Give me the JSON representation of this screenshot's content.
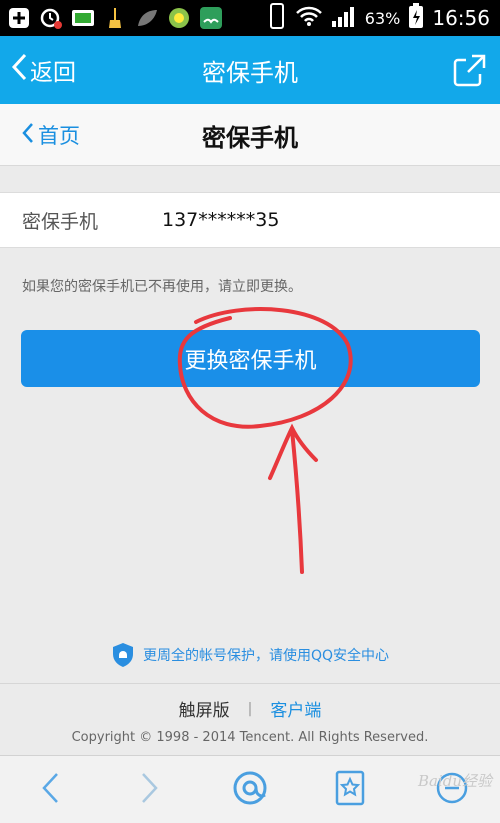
{
  "status_bar": {
    "battery_percent": "63%",
    "time": "16:56"
  },
  "app_bar": {
    "back_label": "返回",
    "title": "密保手机"
  },
  "page_header": {
    "home_label": "首页",
    "title": "密保手机"
  },
  "info": {
    "label": "密保手机",
    "value": "137******35"
  },
  "notice": "如果您的密保手机已不再使用，请立即更换。",
  "change_button": "更换密保手机",
  "security_tip": "更周全的帐号保护，请使用QQ安全中心",
  "footer": {
    "touch_version": "触屏版",
    "separator": "|",
    "client": "客户端",
    "copyright": "Copyright © 1998 - 2014 Tencent. All Rights Reserved."
  },
  "watermark": "Baidu经验",
  "colors": {
    "app_bar": "#12a8ea",
    "button": "#1a8fe8",
    "link": "#1a8fe0",
    "annotation": "#e8383d"
  }
}
